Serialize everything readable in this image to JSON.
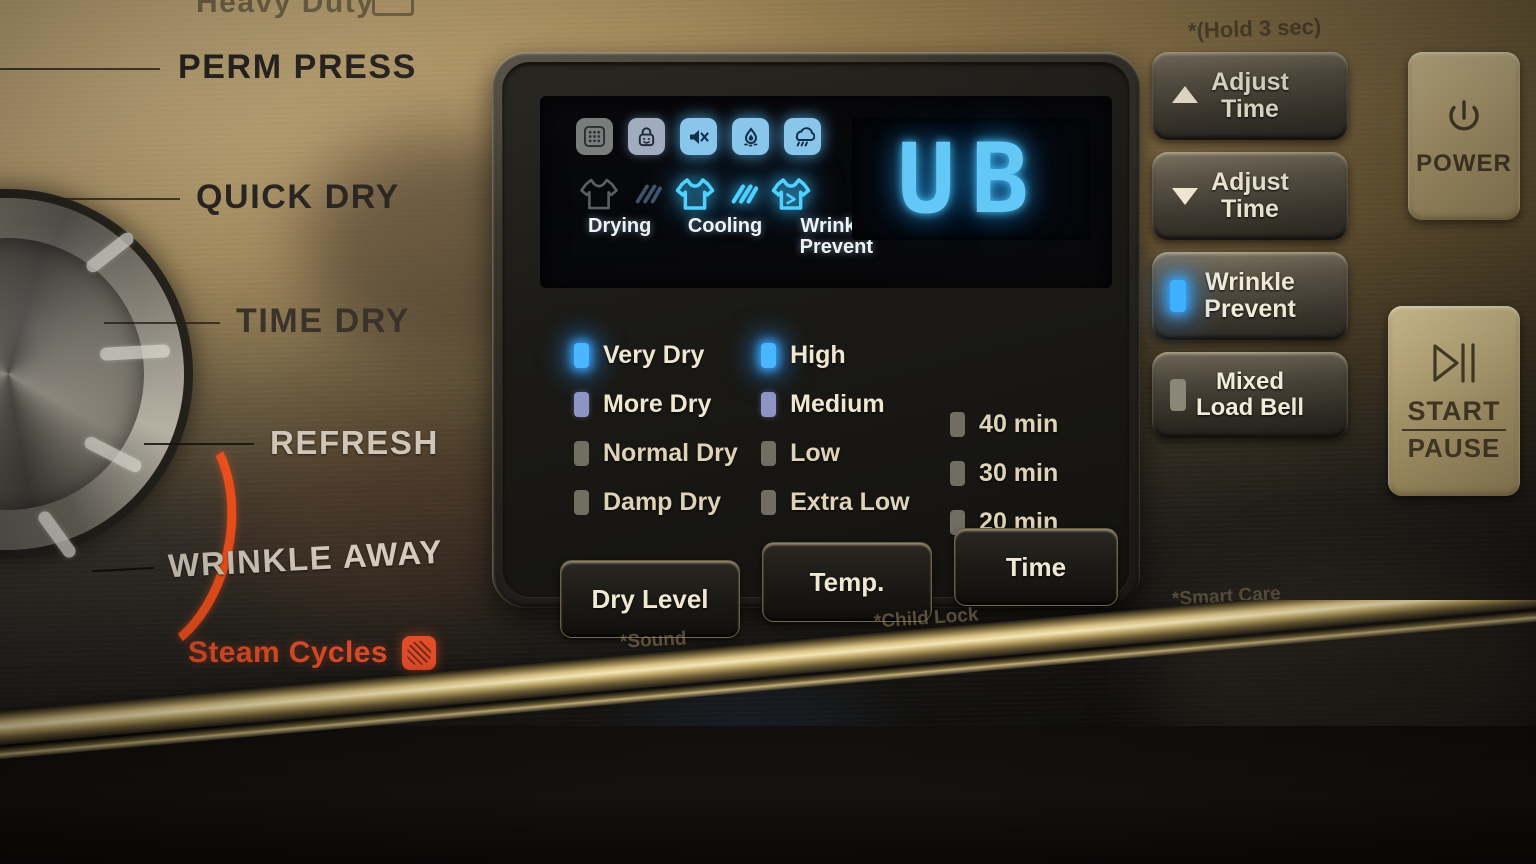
{
  "machine": {
    "top_cut_label": "Heavy Duty",
    "cycle_labels": [
      {
        "name": "PERM PRESS"
      },
      {
        "name": "QUICK DRY"
      },
      {
        "name": "TIME DRY"
      },
      {
        "name": "REFRESH"
      },
      {
        "name": "WRINKLE AWAY"
      }
    ],
    "steam_cycles_label": "Steam Cycles",
    "steam_icon": "steam-icon"
  },
  "display": {
    "code": "UB",
    "status_icons": [
      {
        "name": "filter-grid-icon",
        "state": "dim"
      },
      {
        "name": "child-lock-icon",
        "state": "lit"
      },
      {
        "name": "sound-mute-icon",
        "state": "bright"
      },
      {
        "name": "steam-drop-icon",
        "state": "bright"
      },
      {
        "name": "damp-wet-icon",
        "state": "bright"
      }
    ],
    "progress": [
      {
        "label": "Drying",
        "state": "off"
      },
      {
        "label": "Cooling",
        "state": "on"
      },
      {
        "label": "Wrinkle Prevent",
        "state": "on"
      }
    ]
  },
  "options": {
    "dry_level": [
      {
        "label": "Very Dry",
        "led": "on"
      },
      {
        "label": "More Dry",
        "led": "mid"
      },
      {
        "label": "Normal Dry",
        "led": "off"
      },
      {
        "label": "Damp Dry",
        "led": "off"
      }
    ],
    "temperature": [
      {
        "label": "High",
        "led": "on"
      },
      {
        "label": "Medium",
        "led": "mid"
      },
      {
        "label": "Low",
        "led": "off"
      },
      {
        "label": "Extra Low",
        "led": "off"
      }
    ],
    "time": [
      {
        "label": "40 min",
        "led": "off"
      },
      {
        "label": "30 min",
        "led": "off"
      },
      {
        "label": "20 min",
        "led": "off"
      }
    ]
  },
  "buttons": {
    "dry_level": "Dry Level",
    "temp": "Temp.",
    "time": "Time",
    "adjust_time_up_line1": "Adjust",
    "adjust_time_up_line2": "Time",
    "adjust_time_down_line1": "Adjust",
    "adjust_time_down_line2": "Time",
    "wrinkle_prevent_line1": "Wrinkle",
    "wrinkle_prevent_line2": "Prevent",
    "wrinkle_prevent_led": "on",
    "mixed_load_bell_line1": "Mixed",
    "mixed_load_bell_line2": "Load Bell",
    "mixed_load_bell_led": "off",
    "power": "POWER",
    "start": "START",
    "pause": "PAUSE"
  },
  "footnotes": {
    "hold": "*(Hold 3 sec)",
    "sound": "*Sound",
    "child_lock": "*Child Lock",
    "smart_care": "*Smart Care"
  },
  "colors": {
    "led_on": "#49b6ff",
    "display_cyan": "#63c8f5",
    "steam_orange": "#e8502a",
    "panel_text": "#efe7cf"
  }
}
